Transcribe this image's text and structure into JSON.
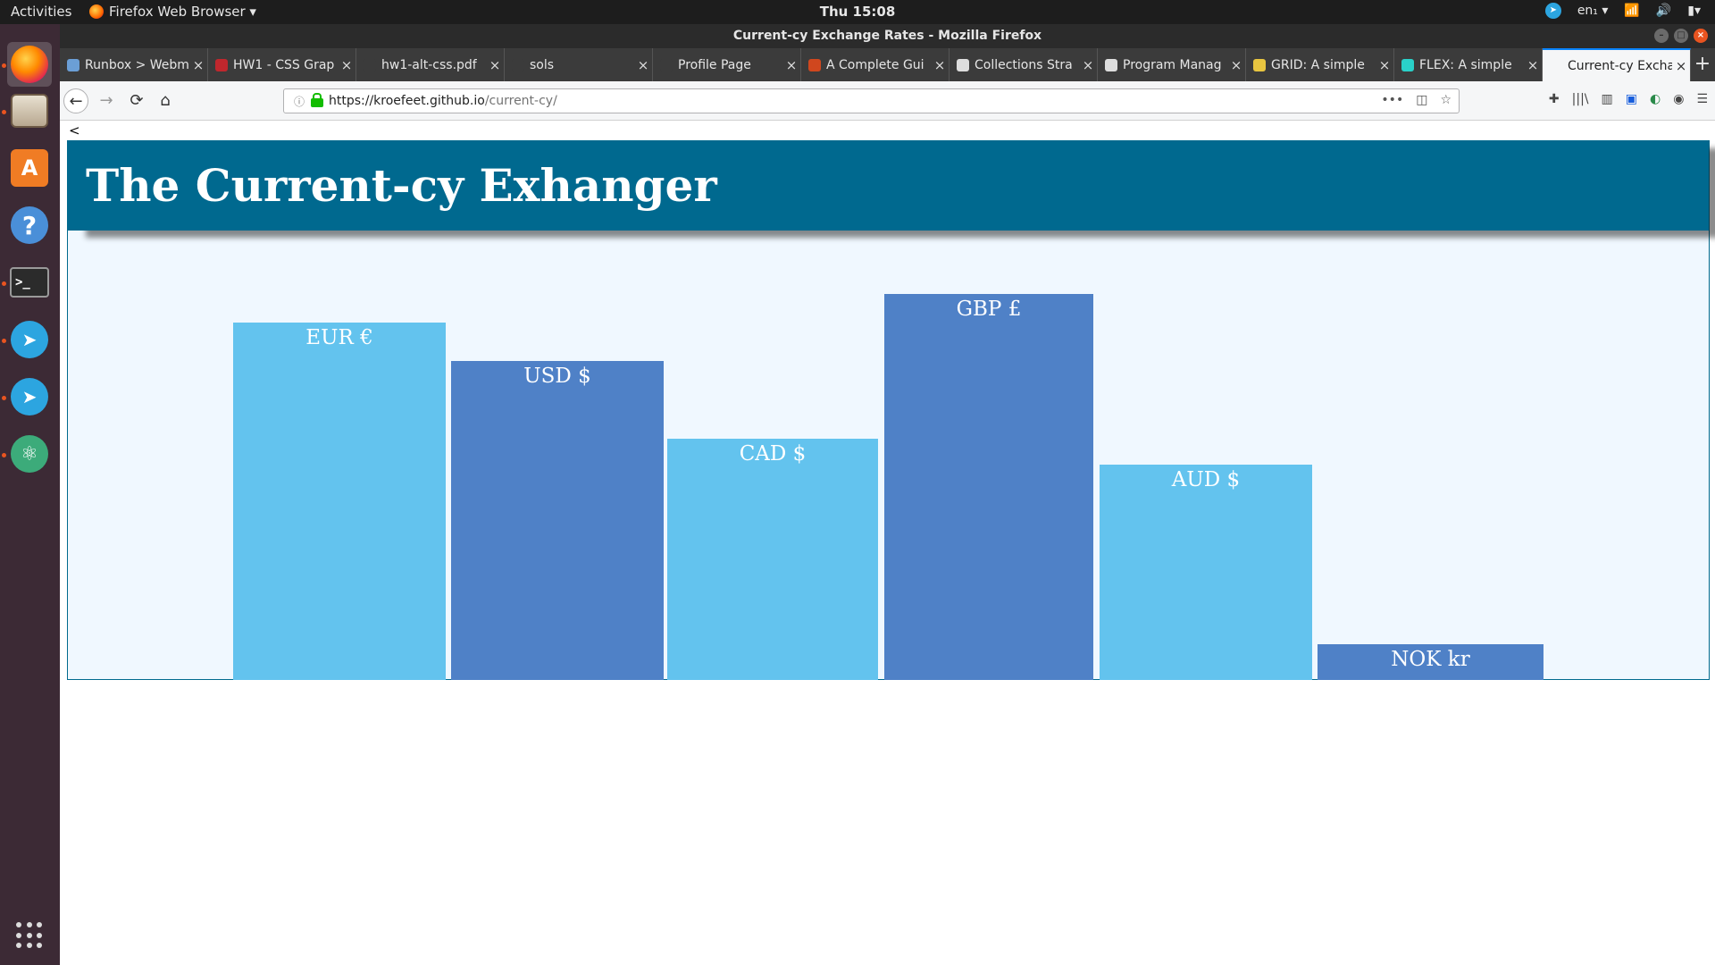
{
  "system": {
    "activities": "Activities",
    "app_menu": "Firefox Web Browser ▾",
    "clock": "Thu 15:08",
    "lang": "en₁ ▾"
  },
  "window": {
    "title": "Current-cy Exchange Rates - Mozilla Firefox"
  },
  "tabs": [
    {
      "label": "Runbox > Webm",
      "color": "#6b9fd6"
    },
    {
      "label": "HW1 - CSS Grap",
      "color": "#c0272d"
    },
    {
      "label": "hw1-alt-css.pdf",
      "color": "#3b3b3b"
    },
    {
      "label": "sols",
      "color": "#3b3b3b"
    },
    {
      "label": "Profile Page",
      "color": "#3b3b3b"
    },
    {
      "label": "A Complete Gui",
      "color": "#d0471e"
    },
    {
      "label": "Collections Stra",
      "color": "#dddddd"
    },
    {
      "label": "Program Manag",
      "color": "#dddddd"
    },
    {
      "label": "GRID: A simple",
      "color": "#e8c540"
    },
    {
      "label": "FLEX: A simple",
      "color": "#2ad1c9"
    },
    {
      "label": "Current-cy Exchang",
      "color": "#f5f6f7"
    }
  ],
  "nav": {
    "url_main": "https://kroefeet.github.io",
    "url_path": "/current-cy/"
  },
  "page": {
    "back_link": "<",
    "title": "The Current-cy Exhanger"
  },
  "colors": {
    "header_bg": "#00698f",
    "bar_light": "#63c3ee",
    "bar_dark": "#4f81c7",
    "frame_bg": "#f0f8ff"
  },
  "chart_data": {
    "type": "bar",
    "categories": [
      "EUR €",
      "USD $",
      "CAD $",
      "GBP £",
      "AUD $",
      "NOK kr"
    ],
    "values": [
      400,
      357,
      270,
      432,
      241,
      40
    ],
    "ylim": [
      0,
      503
    ]
  }
}
